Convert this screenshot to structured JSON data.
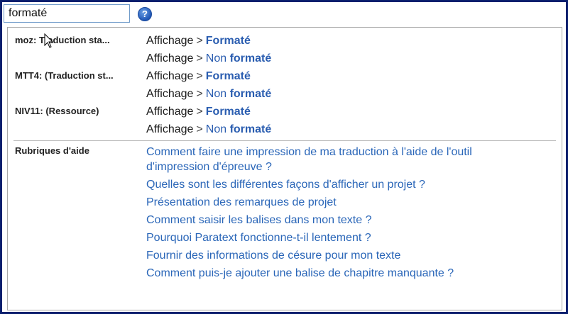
{
  "search": {
    "value": "formaté"
  },
  "help_button": {
    "label": "?"
  },
  "groups": [
    {
      "label": "moz: Traduction sta...",
      "results": [
        {
          "menu": "Affichage",
          "sep": ">",
          "prefix": "",
          "item": "Formaté"
        },
        {
          "menu": "Affichage",
          "sep": ">",
          "prefix": "Non ",
          "item": "formaté"
        }
      ]
    },
    {
      "label": "MTT4: (Traduction st...",
      "results": [
        {
          "menu": "Affichage",
          "sep": ">",
          "prefix": "",
          "item": "Formaté"
        },
        {
          "menu": "Affichage",
          "sep": ">",
          "prefix": "Non ",
          "item": "formaté"
        }
      ]
    },
    {
      "label": "NIV11: (Ressource)",
      "results": [
        {
          "menu": "Affichage",
          "sep": ">",
          "prefix": "",
          "item": "Formaté"
        },
        {
          "menu": "Affichage",
          "sep": ">",
          "prefix": "Non ",
          "item": "formaté"
        }
      ]
    }
  ],
  "help_topics": {
    "label": "Rubriques d'aide",
    "items": [
      "Comment faire une impression de ma traduction à l'aide de l'outil d'impression d'épreuve ?",
      "Quelles sont les différentes façons d'afficher un projet ?",
      "Présentation des remarques de projet",
      "Comment saisir les balises dans mon texte ?",
      "Pourquoi Paratext fonctionne-t-il lentement ?",
      "Fournir des informations de césure pour mon texte",
      "Comment puis-je ajouter une balise de chapitre manquante ?"
    ]
  },
  "colors": {
    "window_border": "#0a1f6e",
    "link": "#2a66b8",
    "accent": "#2a5db0"
  }
}
